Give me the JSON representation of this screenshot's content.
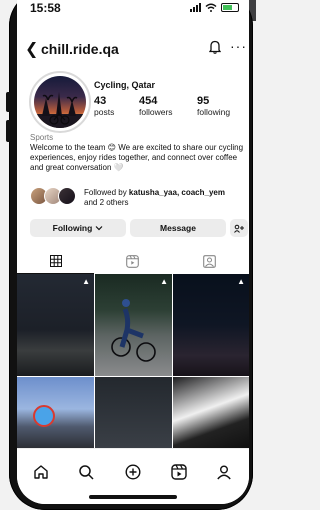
{
  "status_bar": {
    "time": "15:58"
  },
  "profile": {
    "username": "chill.ride.qa",
    "category": "Cycling, Qatar",
    "stats": [
      {
        "value": "43",
        "label": "posts"
      },
      {
        "value": "454",
        "label": "followers"
      },
      {
        "value": "95",
        "label": "following"
      }
    ],
    "label": "Sports",
    "bio": "Welcome to the team 😊 We are excited to share our cycling experiences, enjoy rides together, and connect over coffee and great conversation 🤍",
    "followed_by": {
      "prefix": "Followed by ",
      "names": "katusha_yaa, coach_yem",
      "suffix": "and 2 others"
    }
  },
  "actions": {
    "following_label": "Following",
    "message_label": "Message"
  },
  "tabs": [
    {
      "name": "grid",
      "icon": "grid-icon",
      "active": true
    },
    {
      "name": "reels",
      "icon": "reels-icon",
      "active": false
    },
    {
      "name": "tagged",
      "icon": "tagged-icon",
      "active": false
    }
  ],
  "nav": [
    "home-icon",
    "search-icon",
    "create-icon",
    "reels-icon",
    "profile-icon"
  ],
  "colors": {
    "accent": "#111111",
    "button_bg": "#ececec",
    "battery": "#40c057"
  }
}
